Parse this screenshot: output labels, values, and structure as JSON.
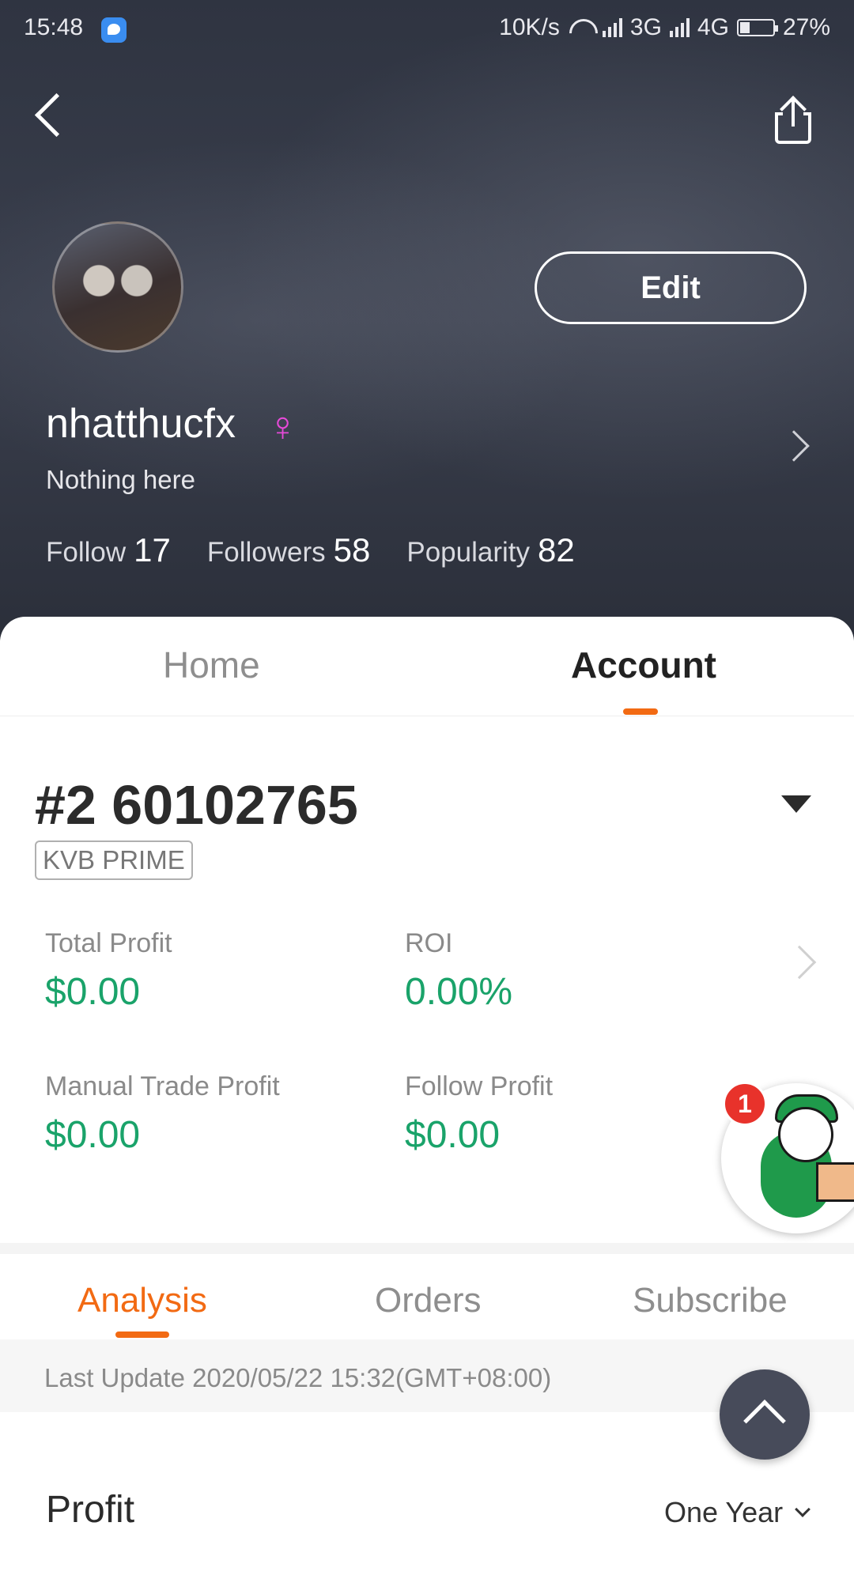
{
  "status_bar": {
    "time": "15:48",
    "network_speed": "10K/s",
    "net1": "3G",
    "net2": "4G",
    "battery": "27%",
    "battery_level": 0.27
  },
  "header": {
    "edit_label": "Edit",
    "username": "nhatthucfx",
    "gender_icon": "♀",
    "bio": "Nothing here",
    "stats": [
      {
        "label": "Follow",
        "value": "17"
      },
      {
        "label": "Followers",
        "value": "58"
      },
      {
        "label": "Popularity",
        "value": "82"
      }
    ]
  },
  "tabs": {
    "home": "Home",
    "account": "Account",
    "active": "account"
  },
  "account": {
    "number": "#2 60102765",
    "broker": "KVB PRIME",
    "metrics": [
      {
        "label": "Total Profit",
        "value": "$0.00"
      },
      {
        "label": "ROI",
        "value": "0.00%"
      },
      {
        "label": "Manual Trade Profit",
        "value": "$0.00"
      },
      {
        "label": "Follow Profit",
        "value": "$0.00"
      }
    ]
  },
  "sub_tabs": {
    "analysis": "Analysis",
    "orders": "Orders",
    "subscribe": "Subscribe",
    "active": "analysis"
  },
  "update": {
    "text": "Last Update 2020/05/22 15:32(GMT+08:00)"
  },
  "profit": {
    "title": "Profit",
    "range": "One Year"
  },
  "mascot": {
    "badge_count": "1"
  },
  "colors": {
    "accent": "#f26a13",
    "profit_green": "#1aa36a",
    "badge_red": "#e8322b"
  }
}
